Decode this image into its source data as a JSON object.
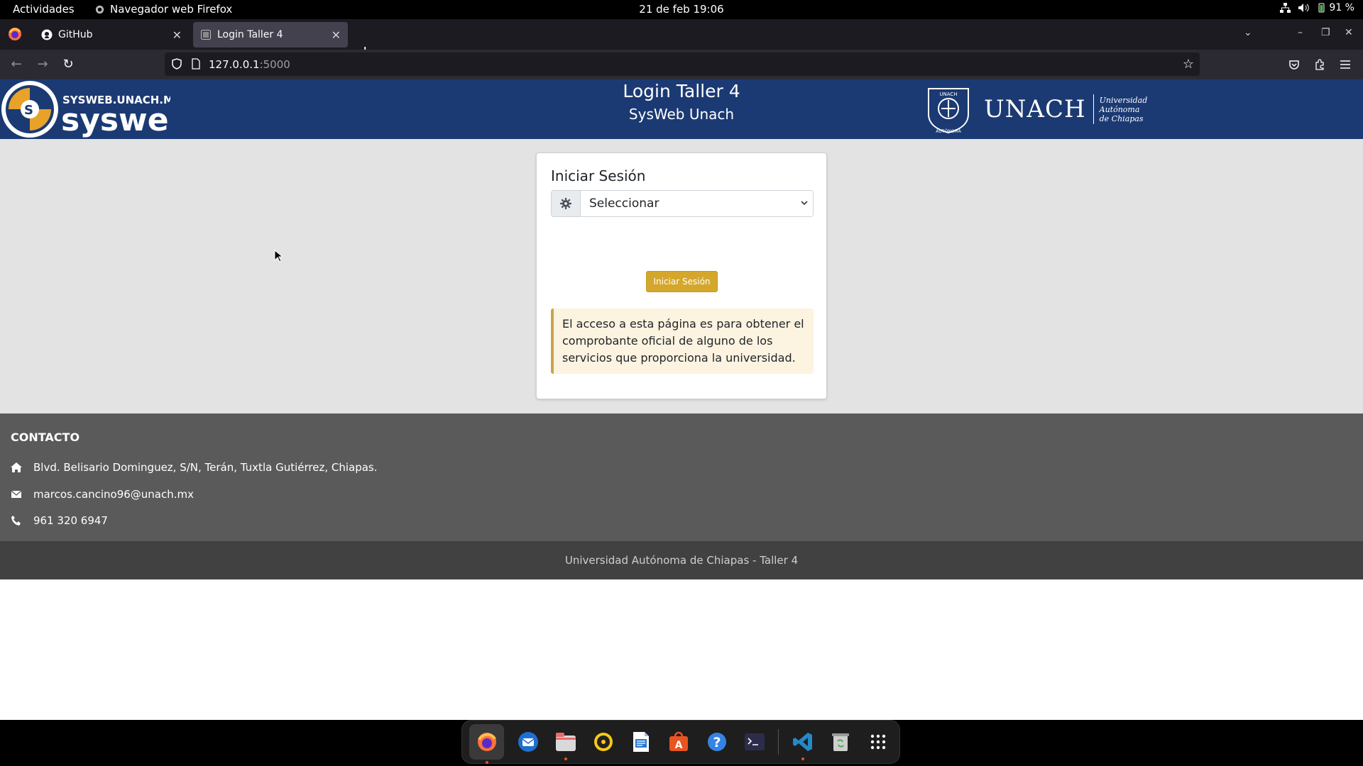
{
  "topbar": {
    "activities": "Actividades",
    "app_name": "Navegador web Firefox",
    "clock": "21 de feb  19:06",
    "battery": "91 %"
  },
  "browser": {
    "tabs": [
      {
        "title": "GitHub",
        "icon": "github-icon",
        "active": false
      },
      {
        "title": "Login Taller 4",
        "icon": "page-icon",
        "active": true
      }
    ],
    "url_host": "127.0.0.1",
    "url_port": ":5000"
  },
  "header": {
    "site_logo_text_top": "SYSWEB.UNACH.MX",
    "site_logo_text_main": "sysweb",
    "title": "Login Taller 4",
    "subtitle": "SysWeb Unach",
    "brand_word": "UNACH",
    "brand_sub_1": "Universidad",
    "brand_sub_2": "Autónoma",
    "brand_sub_3": "de Chiapas",
    "seal_top": "UNACH",
    "seal_bottom": "AUTÓNOMA"
  },
  "login": {
    "heading": "Iniciar Sesión",
    "select_value": "Seleccionar",
    "submit_label": "Iniciar Sesión",
    "notice": "El acceso a esta página es para obtener el comprobante oficial de alguno de los servicios que proporciona la universidad."
  },
  "footer": {
    "heading": "CONTACTO",
    "address": "Blvd. Belisario Dominguez, S/N, Terán, Tuxtla Gutiérrez, Chiapas.",
    "email": "marcos.cancino96@unach.mx",
    "phone": "961 320 6947",
    "copyright": "Universidad Autónoma de Chiapas - Taller 4"
  },
  "colors": {
    "header_bg": "#1b3a73",
    "content_bg": "#e3e3e3",
    "button_bg": "#d4a72c",
    "notice_bg": "#fcf3e0",
    "footer_bg": "#5a5a5a",
    "copyright_bg": "#414141"
  },
  "dock": {
    "items": [
      "firefox-icon",
      "thunderbird-icon",
      "files-icon",
      "rhythmbox-icon",
      "writer-icon",
      "app-center-icon",
      "help-icon",
      "terminal-icon",
      "vscode-icon",
      "trash-icon",
      "app-grid-icon"
    ]
  }
}
